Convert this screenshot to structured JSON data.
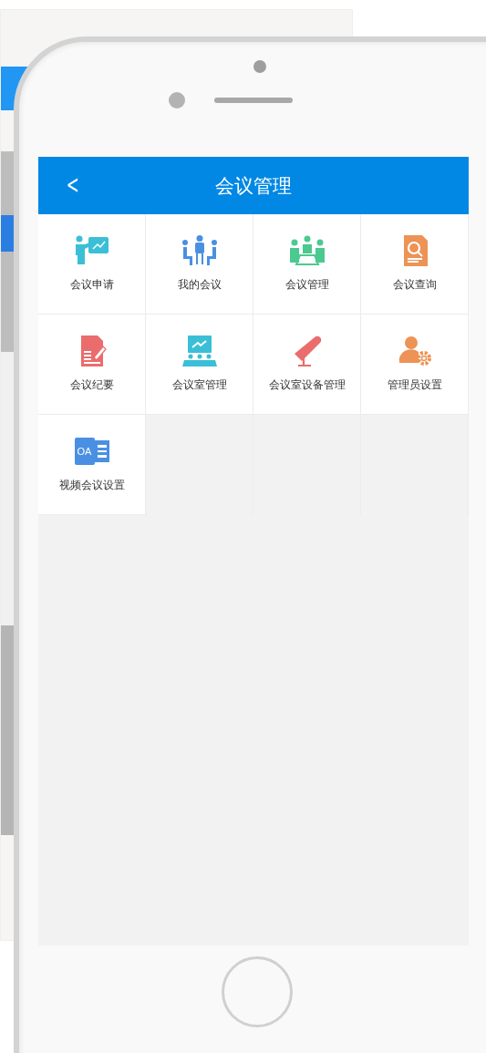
{
  "header": {
    "back": "<",
    "title": "会议管理"
  },
  "tiles": [
    {
      "label": "会议申请",
      "kind": "presenter"
    },
    {
      "label": "我的会议",
      "kind": "meeting"
    },
    {
      "label": "会议管理",
      "kind": "team"
    },
    {
      "label": "会议查询",
      "kind": "search"
    },
    {
      "label": "会议纪要",
      "kind": "notes"
    },
    {
      "label": "会议室管理",
      "kind": "room"
    },
    {
      "label": "会议室设备管理",
      "kind": "mic"
    },
    {
      "label": "管理员设置",
      "kind": "admin"
    },
    {
      "label": "视频会议设置",
      "kind": "oa",
      "icon_text": "OA"
    }
  ]
}
